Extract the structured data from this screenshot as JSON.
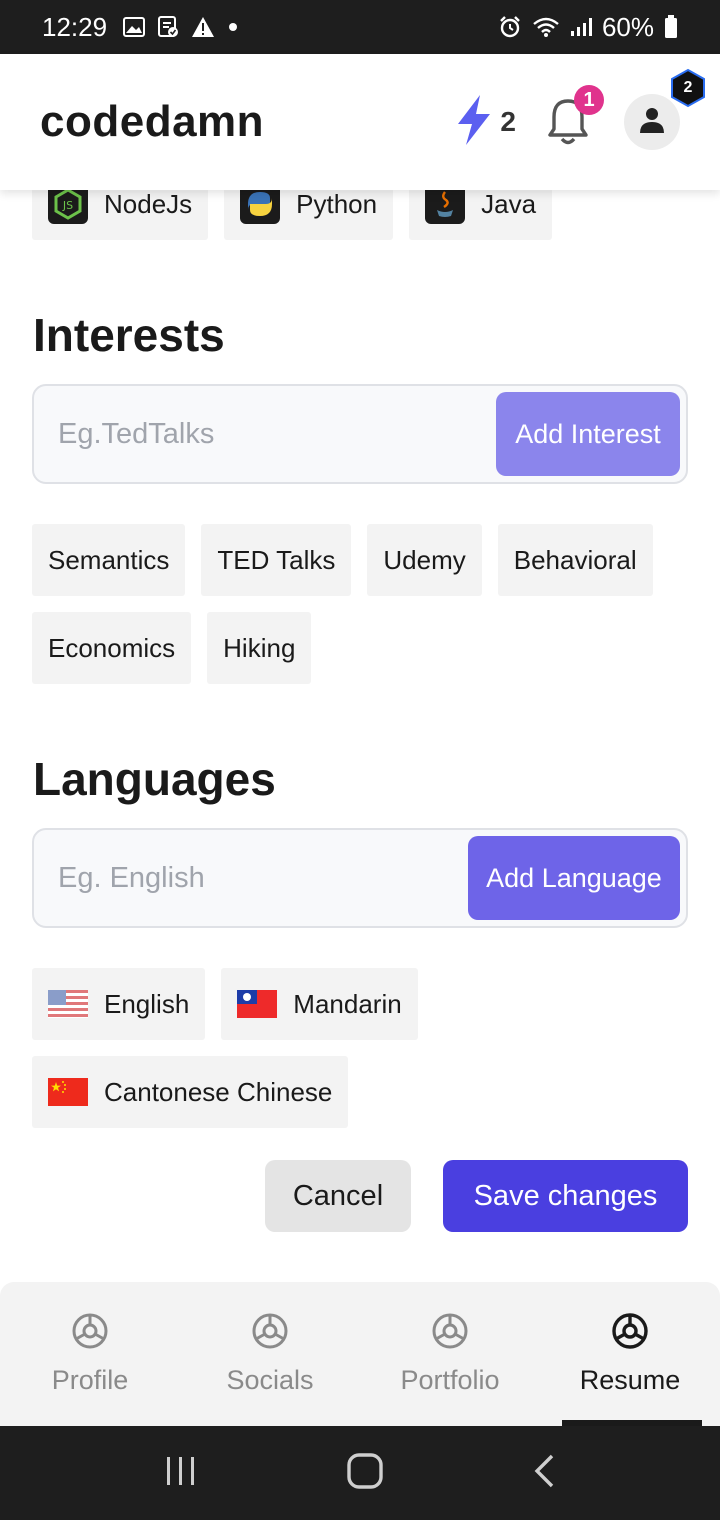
{
  "status_bar": {
    "time": "12:29",
    "battery": "60%"
  },
  "header": {
    "logo": "codedamn",
    "bolt_count": "2",
    "notifications_count": "1",
    "level_badge": "2"
  },
  "skills": [
    {
      "label": "NodeJs",
      "icon": "nodejs-icon"
    },
    {
      "label": "Python",
      "icon": "python-icon"
    },
    {
      "label": "Java",
      "icon": "java-icon"
    }
  ],
  "interests": {
    "heading": "Interests",
    "placeholder": "Eg.TedTalks",
    "add_label": "Add Interest",
    "items": [
      "Semantics",
      "TED Talks",
      "Udemy",
      "Behavioral",
      "Economics",
      "Hiking"
    ]
  },
  "languages": {
    "heading": "Languages",
    "placeholder": "Eg. English",
    "add_label": "Add Language",
    "items": [
      {
        "label": "English",
        "flag": "us-flag-icon"
      },
      {
        "label": "Mandarin",
        "flag": "taiwan-flag-icon"
      },
      {
        "label": "Cantonese Chinese",
        "flag": "china-flag-icon"
      }
    ]
  },
  "actions": {
    "cancel": "Cancel",
    "save": "Save changes"
  },
  "tabs": [
    {
      "label": "Profile",
      "active": false
    },
    {
      "label": "Socials",
      "active": false
    },
    {
      "label": "Portfolio",
      "active": false
    },
    {
      "label": "Resume",
      "active": true
    }
  ],
  "colors": {
    "primary": "#4a3fe0",
    "add_interest_bg": "#8b85ec",
    "add_language_bg": "#6e64e8",
    "badge_pink": "#e0338d"
  }
}
